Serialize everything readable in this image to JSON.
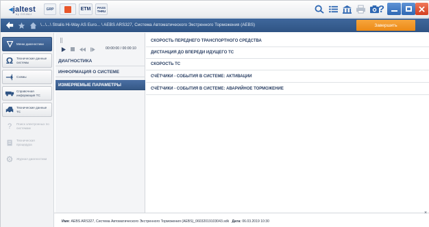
{
  "app": {
    "logo_text": "jaltest",
    "logo_sub": "by COJALI",
    "grp_label": "GRP",
    "etm_label": "ETM",
    "pass_line1": "PASS",
    "pass_line2": "THRU"
  },
  "navbar": {
    "breadcrumb": "\\...\\...\\ Stralis Hi-Way AS Euro... \\ AEBS ARS327, Система Автоматического Экстренного Торможения (AEBS)",
    "finish_label": "Завершить"
  },
  "sidebar": {
    "items": [
      {
        "label": "Меню диагностики"
      },
      {
        "label": "Технические данные системы"
      },
      {
        "label": "Схемы"
      },
      {
        "label": "Справочная информация ТС"
      },
      {
        "label": "Технические данные ТС"
      },
      {
        "label": "Поиск электронных по системам"
      },
      {
        "label": "Техническая процедура"
      },
      {
        "label": "Журнал диагностики"
      }
    ]
  },
  "player": {
    "timecode": "00:00:00 / 00:00:10"
  },
  "middle": {
    "items": [
      {
        "label": "ДИАГНОСТИКА"
      },
      {
        "label": "ИНФОРМАЦИЯ О СИСТЕМЕ"
      },
      {
        "label": "ИЗМЕРЯЕМЫЕ ПАРАМЕТРЫ"
      }
    ]
  },
  "params": [
    {
      "label": "СКОРОСТЬ ПЕРЕДНЕГО ТРАНСПОРТНОГО СРЕДСТВА"
    },
    {
      "label": "ДИСТАНЦИЯ ДО ВПЕРЕДИ ИДУЩЕГО ТС"
    },
    {
      "label": "СКОРОСТЬ ТС"
    },
    {
      "label": "СЧЁТЧИКИ - СОБЫТИЯ В СИСТЕМЕ: АКТИВАЦИИ"
    },
    {
      "label": "СЧЁТЧИКИ - СОБЫТИЯ В СИСТЕМЕ: АВАРИЙНОЕ ТОРМОЖЕНИЕ"
    }
  ],
  "bottom": {
    "name_label": "Имя:",
    "name_value": "AEBS ARS327, Система Автоматического Экстренного Торможения (AEBS)_06032019103043.sdk",
    "date_label": "Дата:",
    "date_value": "06.03.2019 10:30",
    "close_glyph": "×"
  },
  "colors": {
    "nav_blue": "#2f5484",
    "accent_orange": "#ec8a16",
    "selected_blue": "#355886"
  },
  "icons": [
    "home-icon",
    "back-icon",
    "star-icon",
    "camera-icon",
    "help-icon",
    "print-icon",
    "list-icon",
    "search-car-icon",
    "wrench-icon",
    "diagnostics-icon",
    "technical-data-icon",
    "diagram-icon",
    "truck-icon",
    "vehicle-data-icon"
  ]
}
